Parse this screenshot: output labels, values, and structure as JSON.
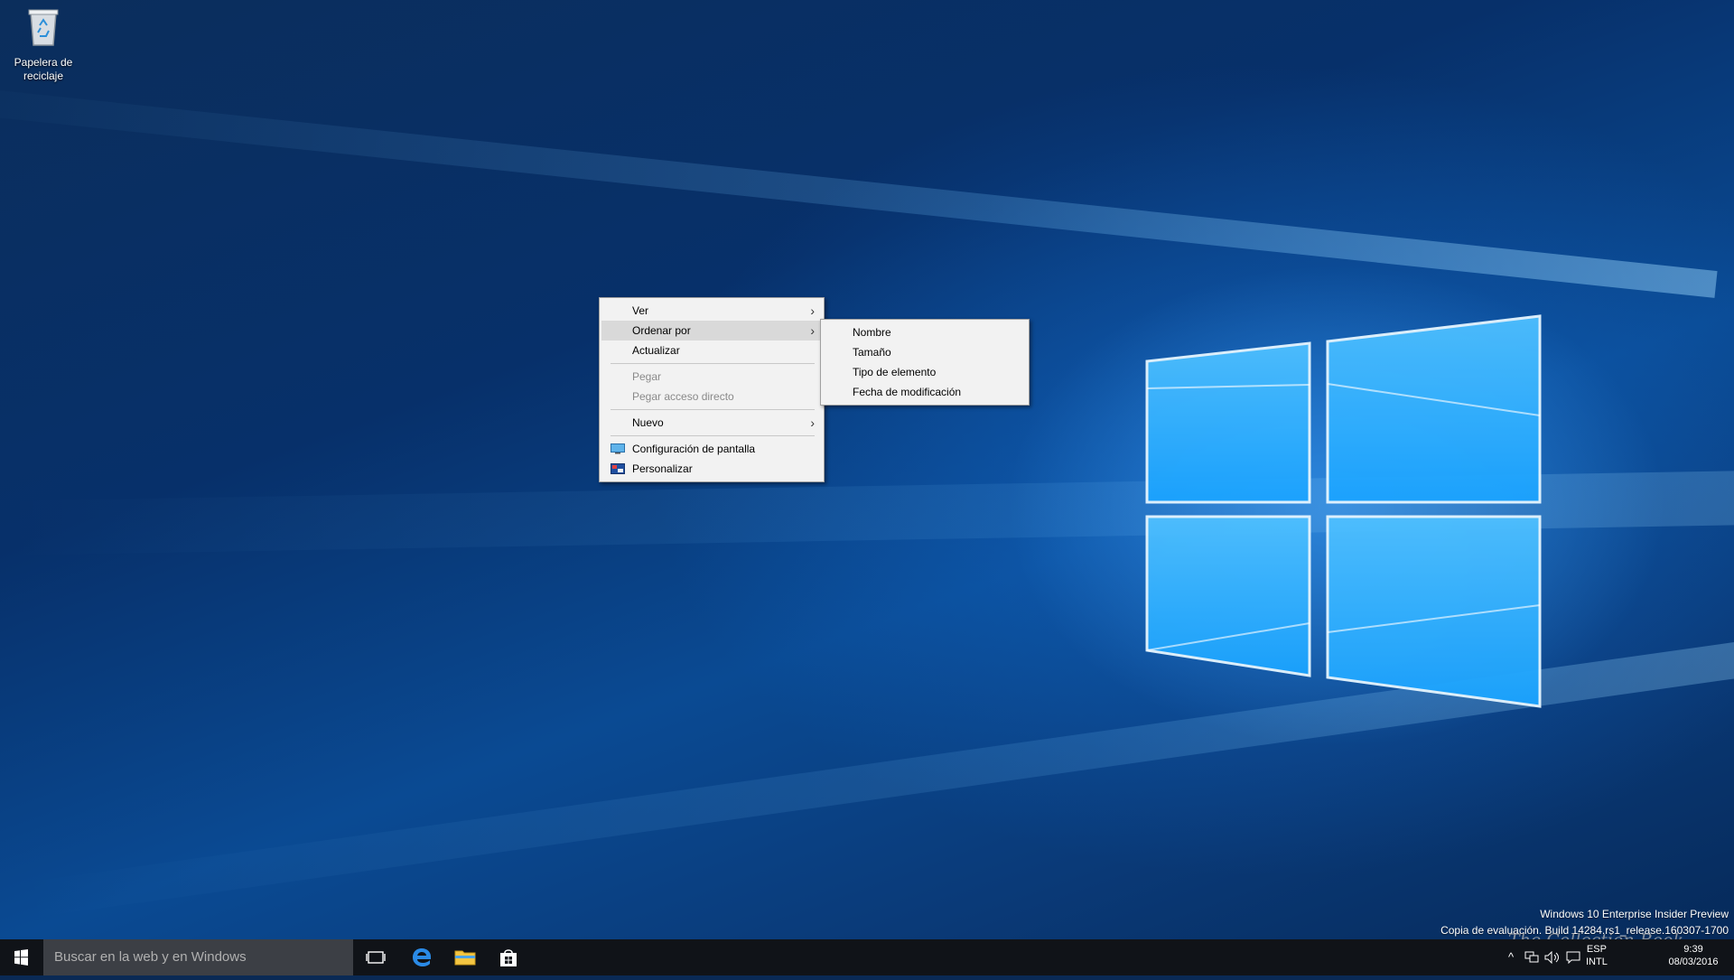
{
  "desktop": {
    "recycle_bin_label_line1": "Papelera de",
    "recycle_bin_label_line2": "reciclaje"
  },
  "context_menu": {
    "view": "Ver",
    "sort_by": "Ordenar por",
    "refresh": "Actualizar",
    "paste": "Pegar",
    "paste_shortcut": "Pegar acceso directo",
    "new": "Nuevo",
    "display_settings": "Configuración de pantalla",
    "personalize": "Personalizar"
  },
  "sort_submenu": {
    "name": "Nombre",
    "size": "Tamaño",
    "item_type": "Tipo de elemento",
    "date_modified": "Fecha de modificación"
  },
  "watermark": {
    "line1": "Windows 10 Enterprise Insider Preview",
    "line2": "Copia de evaluación. Build 14284.rs1_release.160307-1700"
  },
  "overlay_brand": "The Collection Book",
  "taskbar": {
    "search_placeholder": "Buscar en la web y en Windows",
    "language": "ESP",
    "layout": "INTL",
    "time": "9:39",
    "date": "08/03/2016"
  },
  "colors": {
    "accent_blue": "#1e7fe0",
    "taskbar": "#101318",
    "menu_background": "#f2f2f2"
  }
}
